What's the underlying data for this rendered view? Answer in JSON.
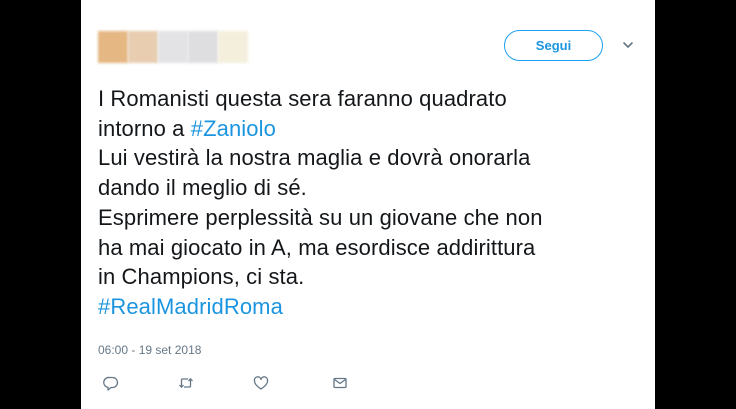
{
  "header": {
    "follow_label": "Segui",
    "author_blur_colors": [
      "#e4b783",
      "#e8cdb0",
      "#e3e3e5",
      "#dedde0",
      "#f4efdd"
    ]
  },
  "tweet": {
    "lines": [
      {
        "text": "I Romanisti questa sera faranno quadrato"
      },
      {
        "text": "intorno a ",
        "hashtag": "#Zaniolo"
      },
      {
        "text": "Lui vestirà la nostra maglia e dovrà onorarla"
      },
      {
        "text": "dando il meglio di sé."
      },
      {
        "text": "Esprimere perplessità su un giovane che non"
      },
      {
        "text": "ha mai giocato in A, ma esordisce addirittura"
      },
      {
        "text": "in Champions, ci sta."
      },
      {
        "text": "",
        "hashtag": "#RealMadridRoma"
      }
    ],
    "timestamp": "06:00 - 19 set 2018"
  },
  "actions": [
    {
      "name": "reply-icon"
    },
    {
      "name": "retweet-icon"
    },
    {
      "name": "like-icon"
    },
    {
      "name": "direct-message-icon"
    }
  ],
  "colors": {
    "accent": "#1b95e0",
    "text": "#14171a",
    "muted": "#657786"
  }
}
